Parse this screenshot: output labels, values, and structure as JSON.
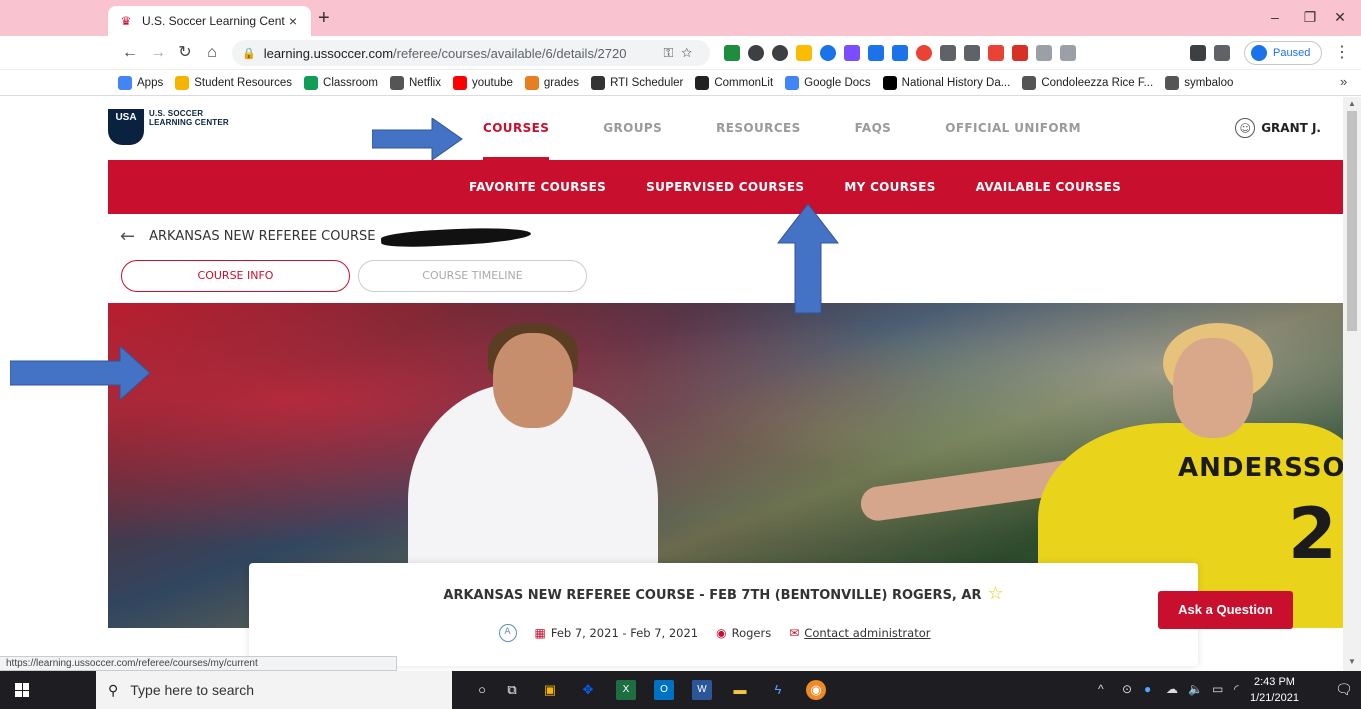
{
  "browser": {
    "tab_title": "U.S. Soccer Learning Center",
    "tab_close": "×",
    "new_tab": "+",
    "window_minimize": "–",
    "window_restore": "❐",
    "window_close": "✕",
    "url_host": "learning.ussoccer.com",
    "url_path": "/referee/courses/available/6/details/2720",
    "profile_status": "Paused",
    "bookmarks": [
      {
        "label": "Apps",
        "color": "#4285f4"
      },
      {
        "label": "Student Resources",
        "color": "#f4b400"
      },
      {
        "label": "Classroom",
        "color": "#0f9d58"
      },
      {
        "label": "Netflix",
        "color": "#555555"
      },
      {
        "label": "youtube",
        "color": "#ff0000"
      },
      {
        "label": "grades",
        "color": "#e67e22"
      },
      {
        "label": "RTI Scheduler",
        "color": "#333333"
      },
      {
        "label": "CommonLit",
        "color": "#222222"
      },
      {
        "label": "Google Docs",
        "color": "#4285f4"
      },
      {
        "label": "National History Da...",
        "color": "#000000"
      },
      {
        "label": "Condoleezza Rice F...",
        "color": "#555555"
      },
      {
        "label": "symbaloo",
        "color": "#555555"
      }
    ],
    "bookmarks_more": "»",
    "status_url": "https://learning.ussoccer.com/referee/courses/my/current"
  },
  "site": {
    "logo_mark": "USA",
    "logo_line1": "U.S. SOCCER",
    "logo_line2": "LEARNING CENTER",
    "nav": [
      {
        "label": "COURSES",
        "active": true
      },
      {
        "label": "GROUPS",
        "active": false
      },
      {
        "label": "RESOURCES",
        "active": false
      },
      {
        "label": "FAQS",
        "active": false
      },
      {
        "label": "OFFICIAL UNIFORM",
        "active": false
      }
    ],
    "user_name": "GRANT J.",
    "subnav": [
      "FAVORITE COURSES",
      "SUPERVISED COURSES",
      "MY COURSES",
      "AVAILABLE COURSES"
    ],
    "breadcrumb_back": "←",
    "breadcrumb_title": "ARKANSAS NEW REFEREE COURSE",
    "tabs": {
      "course_info": "COURSE INFO",
      "course_timeline": "COURSE TIMELINE"
    },
    "hero": {
      "jersey_name": "ANDERSSON",
      "jersey_number": "2"
    },
    "card": {
      "title": "ARKANSAS NEW REFEREE COURSE - FEB 7TH (BENTONVILLE) ROGERS, AR",
      "favorite_star": "☆",
      "dates": "Feb 7, 2021 - Feb 7, 2021",
      "location": "Rogers",
      "contact": "Contact administrator"
    },
    "ask_button": "Ask a Question"
  },
  "taskbar": {
    "search_placeholder": "Type here to search",
    "time": "2:43 PM",
    "date": "1/21/2021"
  },
  "colors": {
    "brand_red": "#c8102e",
    "brand_navy": "#0a2240",
    "annotation_blue": "#4472c4"
  }
}
